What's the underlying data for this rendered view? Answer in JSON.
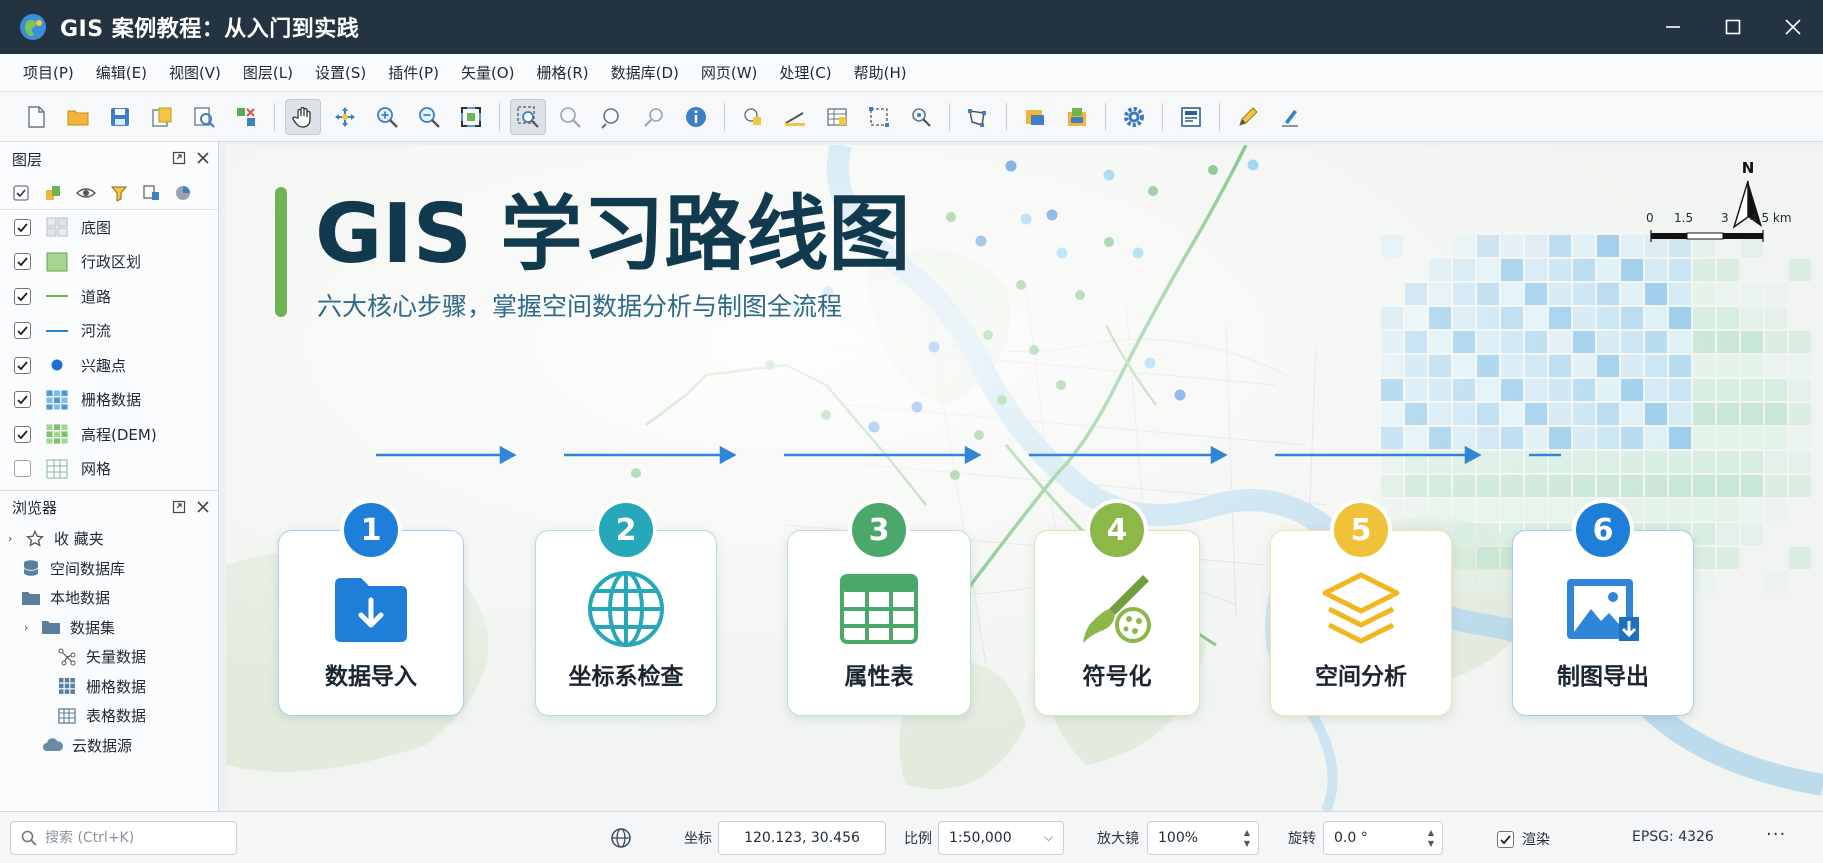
{
  "window": {
    "title": "GIS 案例教程：从入门到实践"
  },
  "menu": [
    "项目(P)",
    "编辑(E)",
    "视图(V)",
    "图层(L)",
    "设置(S)",
    "插件(P)",
    "矢量(O)",
    "栅格(R)",
    "数据库(D)",
    "网页(W)",
    "处理(C)",
    "帮助(H)"
  ],
  "layers_panel": {
    "title": "图层",
    "layers": [
      {
        "label": "底图",
        "checked": true,
        "symbol": "basemap-icon"
      },
      {
        "label": "行政区划",
        "checked": true,
        "symbol": "polygon-fill-symbol"
      },
      {
        "label": "道路",
        "checked": true,
        "symbol": "green-line-symbol"
      },
      {
        "label": "河流",
        "checked": true,
        "symbol": "blue-line-symbol"
      },
      {
        "label": "兴趣点",
        "checked": true,
        "symbol": "blue-point-symbol"
      },
      {
        "label": "栅格数据",
        "checked": true,
        "symbol": "raster-blue-icon"
      },
      {
        "label": "高程(DEM)",
        "checked": true,
        "symbol": "raster-green-icon"
      },
      {
        "label": "网格",
        "checked": false,
        "symbol": "grid-icon"
      }
    ]
  },
  "browser_panel": {
    "title": "浏览器",
    "items": [
      {
        "label": "收  藏夹",
        "icon": "star-icon",
        "indent": 0,
        "caret": true
      },
      {
        "label": "空间数据库",
        "icon": "database-icon",
        "indent": 1,
        "caret": false
      },
      {
        "label": "本地数据",
        "icon": "folder-icon",
        "indent": 1,
        "caret": false
      },
      {
        "label": "数据集",
        "icon": "folder-icon",
        "indent": 2,
        "caret": true
      },
      {
        "label": "矢量数据",
        "icon": "vector-icon",
        "indent": 3,
        "caret": false
      },
      {
        "label": "栅格数据",
        "icon": "raster-icon",
        "indent": 3,
        "caret": false
      },
      {
        "label": "表格数据",
        "icon": "table-icon",
        "indent": 3,
        "caret": false
      },
      {
        "label": "云数据源",
        "icon": "cloud-icon",
        "indent": 2,
        "caret": false
      }
    ]
  },
  "map": {
    "title": "GIS 学习路线图",
    "subtitle": "六大核心步骤，掌握空间数据分析与制图全流程",
    "north_label": "N",
    "scale_labels": [
      "0",
      "1.5",
      "3",
      "4.5 km"
    ],
    "steps": [
      {
        "num": "1",
        "label": "数据导入",
        "color": "#1f7fd8",
        "border": "#a9cdee",
        "icon": "folder-import-icon"
      },
      {
        "num": "2",
        "label": "坐标系检查",
        "color": "#26a8b8",
        "border": "#b3dde3",
        "icon": "globe-icon"
      },
      {
        "num": "3",
        "label": "属性表",
        "color": "#4aa86a",
        "border": "#c1e0c8",
        "icon": "table-icon"
      },
      {
        "num": "4",
        "label": "符号化",
        "color": "#8cb84a",
        "border": "#d3e6b6",
        "icon": "paintbrush-palette-icon"
      },
      {
        "num": "5",
        "label": "空间分析",
        "color": "#f0c23a",
        "border": "#f3e2ad",
        "icon": "layers-stack-icon"
      },
      {
        "num": "6",
        "label": "制图导出",
        "color": "#1f7fd8",
        "border": "#a9cdee",
        "icon": "map-export-icon"
      }
    ]
  },
  "status": {
    "search_placeholder": "搜索 (Ctrl+K)",
    "coord_label": "坐标",
    "coord_value": "120.123, 30.456",
    "scale_label": "比例",
    "scale_value": "1:50,000",
    "zoom_label": "放大镜",
    "zoom_value": "100%",
    "rotate_label": "旋转",
    "rotate_value": "0.0 °",
    "render_label": "渲染",
    "render_checked": true,
    "epsg": "EPSG: 4326",
    "more": "···"
  }
}
